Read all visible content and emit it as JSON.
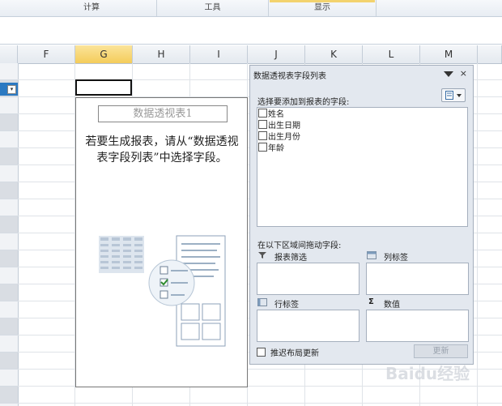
{
  "ribbon": {
    "groups": [
      "计算",
      "工具",
      "显示"
    ]
  },
  "columns": [
    "F",
    "G",
    "H",
    "I",
    "J",
    "K",
    "L",
    "M"
  ],
  "pivot_area": {
    "title": "数据透视表1",
    "message": "若要生成报表，请从“数据透视表字段列表”中选择字段。"
  },
  "field_panel": {
    "title": "数据透视表字段列表",
    "close": "×",
    "choose_label": "选择要添加到报表的字段:",
    "fields": [
      "姓名",
      "出生日期",
      "出生月份",
      "年龄"
    ],
    "drag_label": "在以下区域间拖动字段:",
    "zones": {
      "filter": "报表筛选",
      "column": "列标签",
      "row": "行标签",
      "values": "数值"
    },
    "values_symbol": "Σ",
    "defer_label": "推迟布局更新",
    "update_button": "更新"
  },
  "watermark": "Baidu经验",
  "colors": {
    "accent_selected_column": "#f4cc5a",
    "filter_button": "#2b79c2",
    "panel_bg": "#e3e8ef"
  }
}
